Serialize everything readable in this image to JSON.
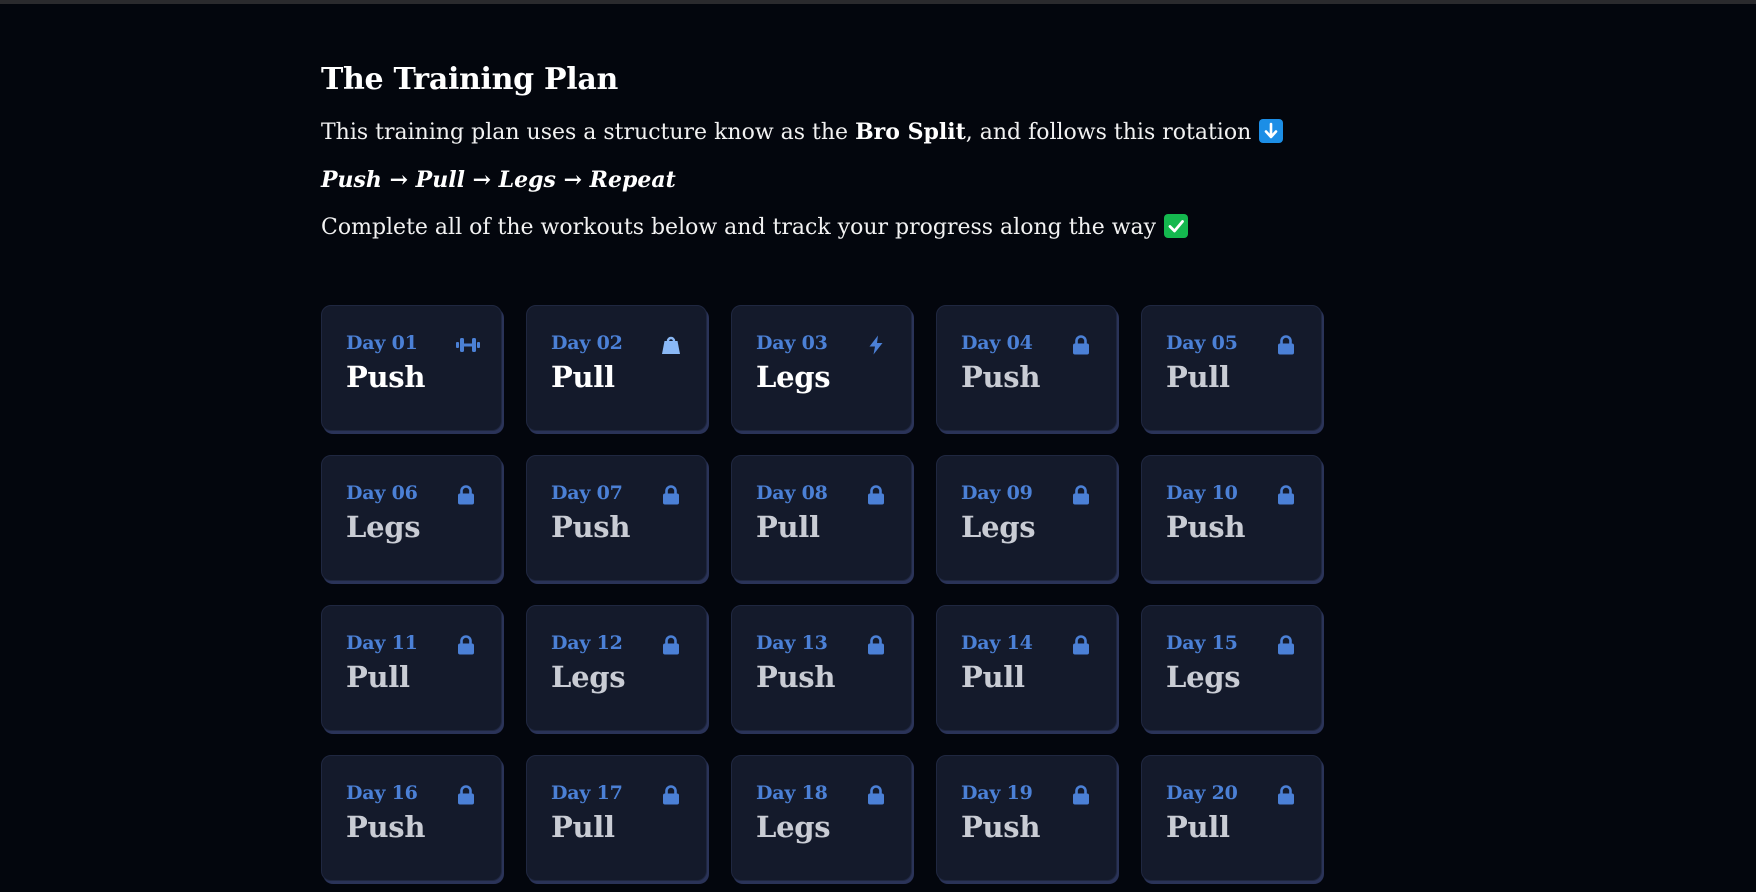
{
  "title": "The Training Plan",
  "intro": {
    "before": "This training plan uses a structure know as the ",
    "bold": "Bro Split",
    "after": ", and follows this rotation",
    "emoji": "down-arrow-icon"
  },
  "rotation": "Push → Pull → Legs → Repeat",
  "instruction": {
    "text": "Complete all of the workouts below and track your progress along the way",
    "emoji": "check-mark-icon"
  },
  "colors": {
    "background": "#03060d",
    "card": "#141a2b",
    "accent": "#4b80d6",
    "check": "#14b84e",
    "arrow": "#1c8ee6"
  },
  "days": [
    {
      "label": "Day 01",
      "type": "Push",
      "icon": "dumbbell-icon",
      "locked": false
    },
    {
      "label": "Day 02",
      "type": "Pull",
      "icon": "weight-bag-icon",
      "locked": false
    },
    {
      "label": "Day 03",
      "type": "Legs",
      "icon": "lightning-bolt-icon",
      "locked": false
    },
    {
      "label": "Day 04",
      "type": "Push",
      "icon": "lock-icon",
      "locked": true
    },
    {
      "label": "Day 05",
      "type": "Pull",
      "icon": "lock-icon",
      "locked": true
    },
    {
      "label": "Day 06",
      "type": "Legs",
      "icon": "lock-icon",
      "locked": true
    },
    {
      "label": "Day 07",
      "type": "Push",
      "icon": "lock-icon",
      "locked": true
    },
    {
      "label": "Day 08",
      "type": "Pull",
      "icon": "lock-icon",
      "locked": true
    },
    {
      "label": "Day 09",
      "type": "Legs",
      "icon": "lock-icon",
      "locked": true
    },
    {
      "label": "Day 10",
      "type": "Push",
      "icon": "lock-icon",
      "locked": true
    },
    {
      "label": "Day 11",
      "type": "Pull",
      "icon": "lock-icon",
      "locked": true
    },
    {
      "label": "Day 12",
      "type": "Legs",
      "icon": "lock-icon",
      "locked": true
    },
    {
      "label": "Day 13",
      "type": "Push",
      "icon": "lock-icon",
      "locked": true
    },
    {
      "label": "Day 14",
      "type": "Pull",
      "icon": "lock-icon",
      "locked": true
    },
    {
      "label": "Day 15",
      "type": "Legs",
      "icon": "lock-icon",
      "locked": true
    },
    {
      "label": "Day 16",
      "type": "Push",
      "icon": "lock-icon",
      "locked": true
    },
    {
      "label": "Day 17",
      "type": "Pull",
      "icon": "lock-icon",
      "locked": true
    },
    {
      "label": "Day 18",
      "type": "Legs",
      "icon": "lock-icon",
      "locked": true
    },
    {
      "label": "Day 19",
      "type": "Push",
      "icon": "lock-icon",
      "locked": true
    },
    {
      "label": "Day 20",
      "type": "Pull",
      "icon": "lock-icon",
      "locked": true
    }
  ]
}
